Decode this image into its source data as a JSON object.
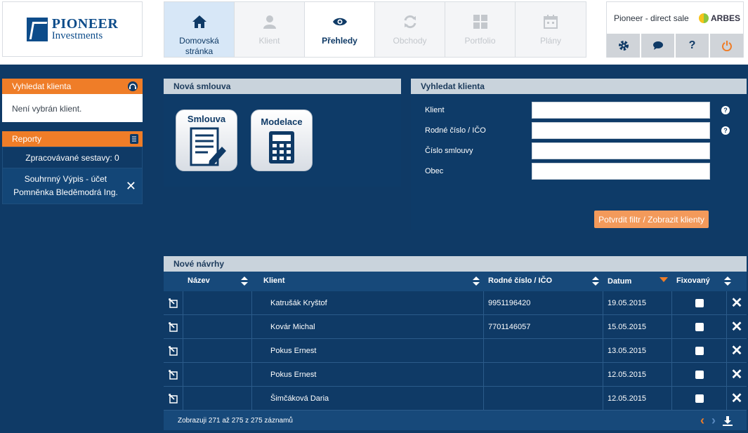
{
  "brand": {
    "line1": "PIONEER",
    "line2": "Investments"
  },
  "nav": [
    {
      "label": "Domovská stránka",
      "icon": "home-icon",
      "state": "active"
    },
    {
      "label": "Klient",
      "icon": "user-icon",
      "state": "disabled"
    },
    {
      "label": "Přehledy",
      "icon": "eye-icon",
      "state": "enabled"
    },
    {
      "label": "Obchody",
      "icon": "refresh-icon",
      "state": "disabled"
    },
    {
      "label": "Portfolio",
      "icon": "grid-icon",
      "state": "disabled"
    },
    {
      "label": "Plány",
      "icon": "calendar-icon",
      "state": "disabled"
    }
  ],
  "header_right": {
    "context": "Pioneer - direct sale",
    "partner": "ARBES",
    "buttons": [
      "gear-icon",
      "chat-icon",
      "help-icon",
      "power-icon"
    ]
  },
  "left_search": {
    "title": "Vyhledat klienta",
    "message": "Není vybrán klient."
  },
  "reports": {
    "title": "Reporty",
    "processing": "Zpracovávané sestavy: 0",
    "item": "Souhrnný Výpis - účet Pomněnka Bleděmodrá Ing."
  },
  "new_contract": {
    "title": "Nová smlouva",
    "tiles": [
      "Smlouva",
      "Modelace"
    ]
  },
  "search_form": {
    "title": "Vyhledat klienta",
    "fields": [
      {
        "label": "Klient",
        "value": "",
        "help": true
      },
      {
        "label": "Rodné číslo / IČO",
        "value": "",
        "help": true
      },
      {
        "label": "Číslo smlouvy",
        "value": "",
        "help": false
      },
      {
        "label": "Obec",
        "value": "",
        "help": false
      }
    ],
    "submit": "Potvrdit filtr / Zobrazit klienty"
  },
  "proposals": {
    "title": "Nové návrhy",
    "columns": [
      "Název",
      "Klient",
      "Rodné číslo / IČO",
      "Datum",
      "Fixovaný"
    ],
    "rows": [
      {
        "nazev": "",
        "klient": "Katrušák Kryštof",
        "rc": "9951196420",
        "datum": "19.05.2015"
      },
      {
        "nazev": "",
        "klient": "Kovár Michal",
        "rc": "7701146057",
        "datum": "15.05.2015"
      },
      {
        "nazev": "",
        "klient": "Pokus Ernest",
        "rc": "",
        "datum": "13.05.2015"
      },
      {
        "nazev": "",
        "klient": "Pokus Ernest",
        "rc": "",
        "datum": "12.05.2015"
      },
      {
        "nazev": "",
        "klient": "Šimčáková Daria",
        "rc": "",
        "datum": "12.05.2015"
      }
    ],
    "footer": "Zobrazuji 271 až 275 z 275 záznamů"
  },
  "colors": {
    "navy": "#0f3a66",
    "orange": "#ef7d28",
    "header_grey": "#c9d3dc"
  }
}
